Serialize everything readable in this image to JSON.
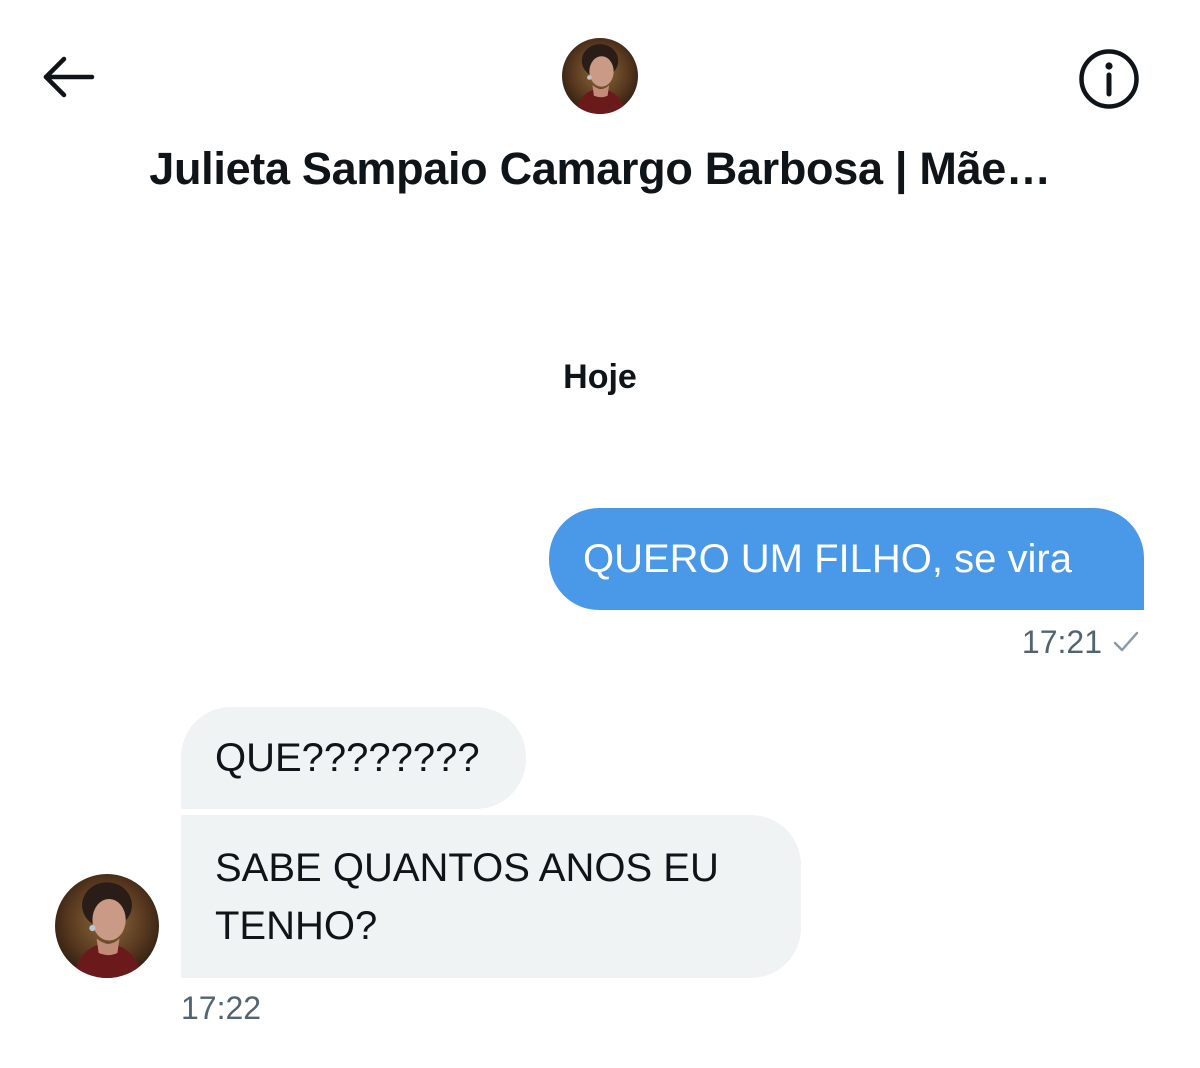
{
  "header": {
    "back_icon": "arrow-left-icon",
    "info_icon": "info-icon",
    "contact_name": "Julieta Sampaio Camargo Barbosa | Mãe…"
  },
  "conversation": {
    "date_divider": "Hoje",
    "messages": [
      {
        "direction": "sent",
        "text": "QUERO UM FILHO, se vira",
        "time": "17:21",
        "status_icon": "check-icon"
      },
      {
        "direction": "received",
        "text": "QUE????????"
      },
      {
        "direction": "received",
        "text": "SABE QUANTOS ANOS EU TENHO?",
        "time": "17:22"
      }
    ]
  },
  "colors": {
    "sent_bubble": "#4a99e9",
    "received_bubble": "#eff3f4",
    "timestamp": "#536471",
    "text": "#0f1419"
  }
}
